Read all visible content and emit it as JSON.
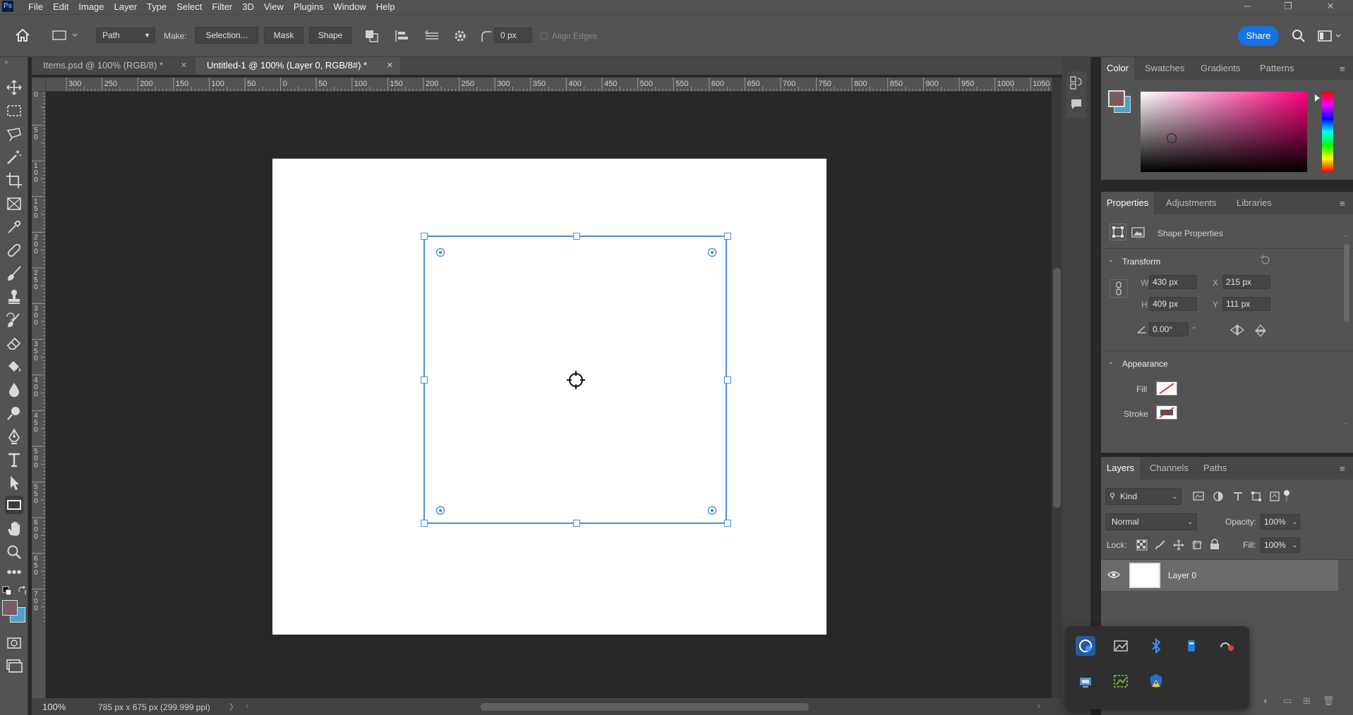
{
  "app": {
    "logo": "Ps",
    "menus": [
      "File",
      "Edit",
      "Image",
      "Layer",
      "Type",
      "Select",
      "Filter",
      "3D",
      "View",
      "Plugins",
      "Window",
      "Help"
    ]
  },
  "options": {
    "mode": "Path",
    "make_label": "Make:",
    "selection": "Selection...",
    "mask": "Mask",
    "shape": "Shape",
    "radius": "0 px",
    "align_edges": "Align Edges",
    "share": "Share"
  },
  "tabs": [
    {
      "label": "Items.psd @ 100% (RGB/8) *"
    },
    {
      "label": "Untitled-1 @ 100% (Layer 0, RGB/8#) *"
    }
  ],
  "ruler": {
    "h": [
      "300",
      "250",
      "200",
      "150",
      "100",
      "50",
      "0",
      "50",
      "100",
      "150",
      "200",
      "250",
      "300",
      "350",
      "400",
      "450",
      "500",
      "550",
      "600",
      "650",
      "700",
      "750",
      "800",
      "850",
      "900",
      "950",
      "1000",
      "1050"
    ],
    "v": [
      "0",
      "50",
      "100",
      "150",
      "200",
      "250",
      "300",
      "350",
      "400",
      "450",
      "500",
      "550",
      "600",
      "650",
      "700"
    ]
  },
  "status": {
    "zoom": "100%",
    "doc": "785 px x 675 px (299.999 ppi)"
  },
  "color_panel": {
    "tabs": [
      "Color",
      "Swatches",
      "Gradients",
      "Patterns"
    ]
  },
  "properties": {
    "tabs": [
      "Properties",
      "Adjustments",
      "Libraries"
    ],
    "title": "Shape Properties",
    "transform_label": "Transform",
    "w_label": "W",
    "w": "430 px",
    "x_label": "X",
    "x": "215 px",
    "h_label": "H",
    "h": "409 px",
    "y_label": "Y",
    "y": "111 px",
    "angle": "0.00°",
    "appearance_label": "Appearance",
    "fill_label": "Fill",
    "stroke_label": "Stroke"
  },
  "layers": {
    "tabs": [
      "Layers",
      "Channels",
      "Paths"
    ],
    "kind": "Kind",
    "blend": "Normal",
    "opacity_label": "Opacity:",
    "opacity": "100%",
    "lock_label": "Lock:",
    "fill_label": "Fill:",
    "fill": "100%",
    "items": [
      {
        "name": "Layer 0"
      }
    ]
  },
  "colors": {
    "accent": "#1473e6",
    "selection": "#4a90d9",
    "fg": "#7d5a63",
    "bg": "#4aa3c8"
  }
}
